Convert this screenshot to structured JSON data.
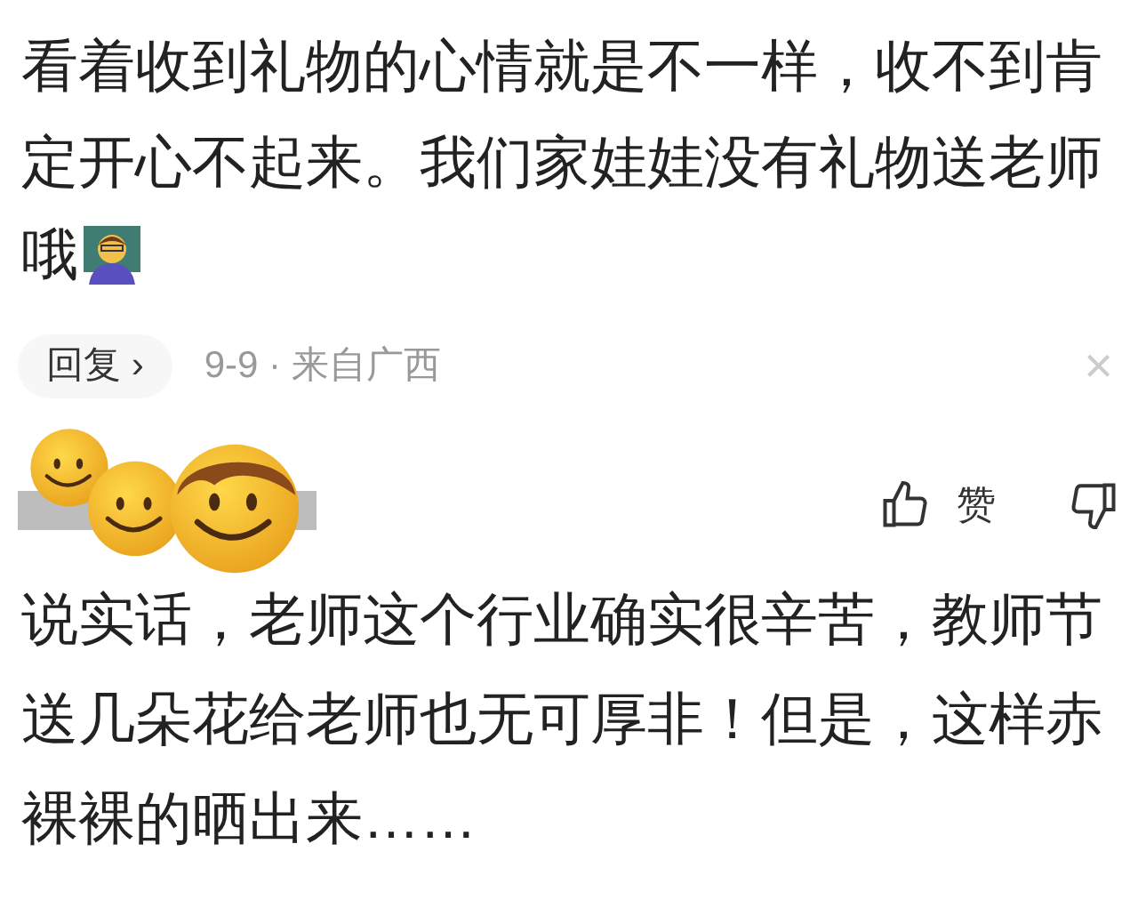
{
  "comments": [
    {
      "text": "看着收到礼物的心情就是不一样，收不到肯定开心不起来。我们家娃娃没有礼物送老师",
      "text_tail": "哦",
      "reply_button": "回复 ›",
      "meta": "9-9 · 来自广西",
      "close": "×"
    },
    {
      "like_label": "赞",
      "text": "说实话，老师这个行业确实很辛苦，教师节送几朵花给老师也无可厚非！但是，这样赤裸裸的晒出来……"
    }
  ]
}
